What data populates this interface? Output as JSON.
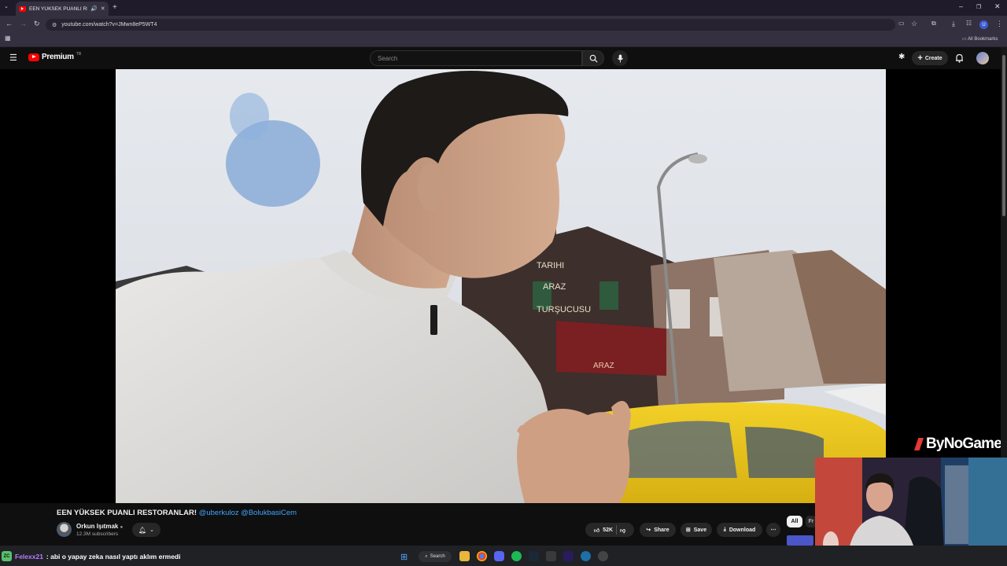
{
  "browser": {
    "tab_title": "EEN YÜKSEK PUANLI RESTO",
    "url": "youtube.com/watch?v=JMwn8eP5WT4",
    "all_bookmarks": "All Bookmarks"
  },
  "youtube": {
    "logo_text": "Premium",
    "logo_country": "TR",
    "search_placeholder": "Search",
    "create_label": "Create"
  },
  "video": {
    "title": "EEN YÜKSEK PUANLI RESTORANLAR!",
    "mentions": "@uberkuloz @BolukbasiCem",
    "sign_text_1": "TARIHI",
    "sign_text_2": "ARAZ",
    "sign_text_3": "TURŞUCUSU",
    "awning_text": "ARAZ"
  },
  "channel": {
    "name": "Orkun Işıtmak",
    "subscribers": "12.3M subscribers"
  },
  "actions": {
    "likes": "52K",
    "share": "Share",
    "save": "Save",
    "download": "Download"
  },
  "chips": {
    "all": "All",
    "second": "Fr"
  },
  "overlay": {
    "brand": "ByNoGame"
  },
  "chat": {
    "badge": "ZC",
    "username": "Felexx21",
    "message": ": abi o yapay zeka nasıl yaptı aklım ermedi"
  },
  "taskbar": {
    "search": "Search"
  },
  "colors": {
    "youtube_red": "#ff0000",
    "mention_blue": "#3ea6ff",
    "brand_red": "#e53935",
    "chat_user": "#b77bff"
  }
}
